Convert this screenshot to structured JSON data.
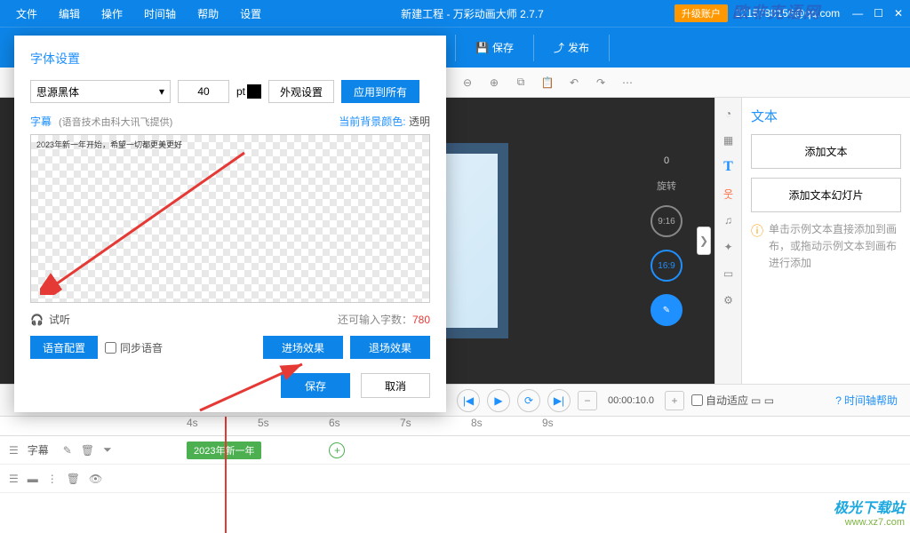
{
  "titlebar": {
    "title": "新建工程 - 万彩动画大师 2.7.7",
    "upgrade": "升级账户",
    "account": "2215788156@qq.com"
  },
  "menu": [
    "文件",
    "编辑",
    "操作",
    "时间轴",
    "帮助",
    "设置"
  ],
  "topbar": {
    "save": "保存",
    "publish": "发布"
  },
  "canvas": {
    "rotate_label": "旋转",
    "rotate_value": "0",
    "ratio1": "9:16",
    "ratio2": "16:9"
  },
  "rpanel": {
    "title": "文本",
    "add_text": "添加文本",
    "add_slide": "添加文本幻灯片",
    "tip": "单击示例文本直接添加到画布，或拖动示例文本到画布进行添加"
  },
  "playbar": {
    "time": "00:00:10.0",
    "autofit": "自动适应",
    "help": "时间轴帮助"
  },
  "ruler": [
    "4s",
    "5s",
    "6s",
    "7s",
    "8s",
    "9s"
  ],
  "track": {
    "label": "字幕",
    "clip": "2023年新一年"
  },
  "modal": {
    "title": "字体设置",
    "font": "思源黑体",
    "size": "40",
    "pt": "pt",
    "appearance": "外观设置",
    "apply_all": "应用到所有",
    "subtitle_lbl": "字幕",
    "subtitle_hint": "(语音技术由科大讯飞提供)",
    "bg_lbl": "当前背景颜色:",
    "bg_val": "透明",
    "preview_text": "2023年新一年开始，希望一切都更美更好",
    "listen": "试听",
    "remain_lbl": "还可输入字数：",
    "remain_val": "780",
    "voice": "语音配置",
    "sync": "同步语音",
    "enter_fx": "进场效果",
    "exit_fx": "退场效果",
    "save": "保存",
    "cancel": "取消"
  },
  "watermark": {
    "line1": "极光下载站",
    "line2": "www.xz7.com",
    "top": "欧非克语网"
  }
}
